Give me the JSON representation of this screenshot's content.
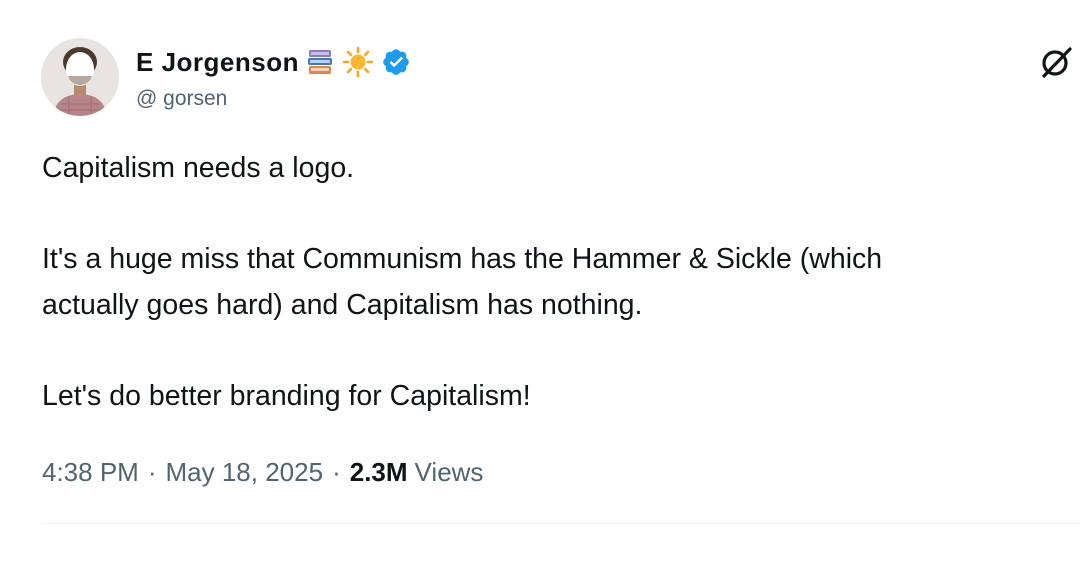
{
  "tweet": {
    "author": {
      "display_name": "E  Jorgenson",
      "handle": "@  gorsen",
      "emojis": [
        "books-emoji",
        "sun-emoji"
      ],
      "verified": true
    },
    "text": {
      "p1": "Capitalism needs a logo.",
      "p2_line1": "It's a huge miss that Communism has the Hammer & Sickle (which",
      "p2_line2": "actually goes hard) and Capitalism has nothing.",
      "p3": "Let's do better branding for Capitalism!"
    },
    "meta": {
      "time": "4:38 PM",
      "separator": "·",
      "date": "May 18, 2025",
      "views_count": "2.3M",
      "views_label": "Views"
    }
  },
  "icons": {
    "grok": "grok-icon",
    "verified": "verified-badge-icon"
  },
  "colors": {
    "primary_text": "#0f1419",
    "secondary_text": "#536471",
    "verified_blue": "#1d9bf0",
    "divider": "#eff3f4"
  }
}
